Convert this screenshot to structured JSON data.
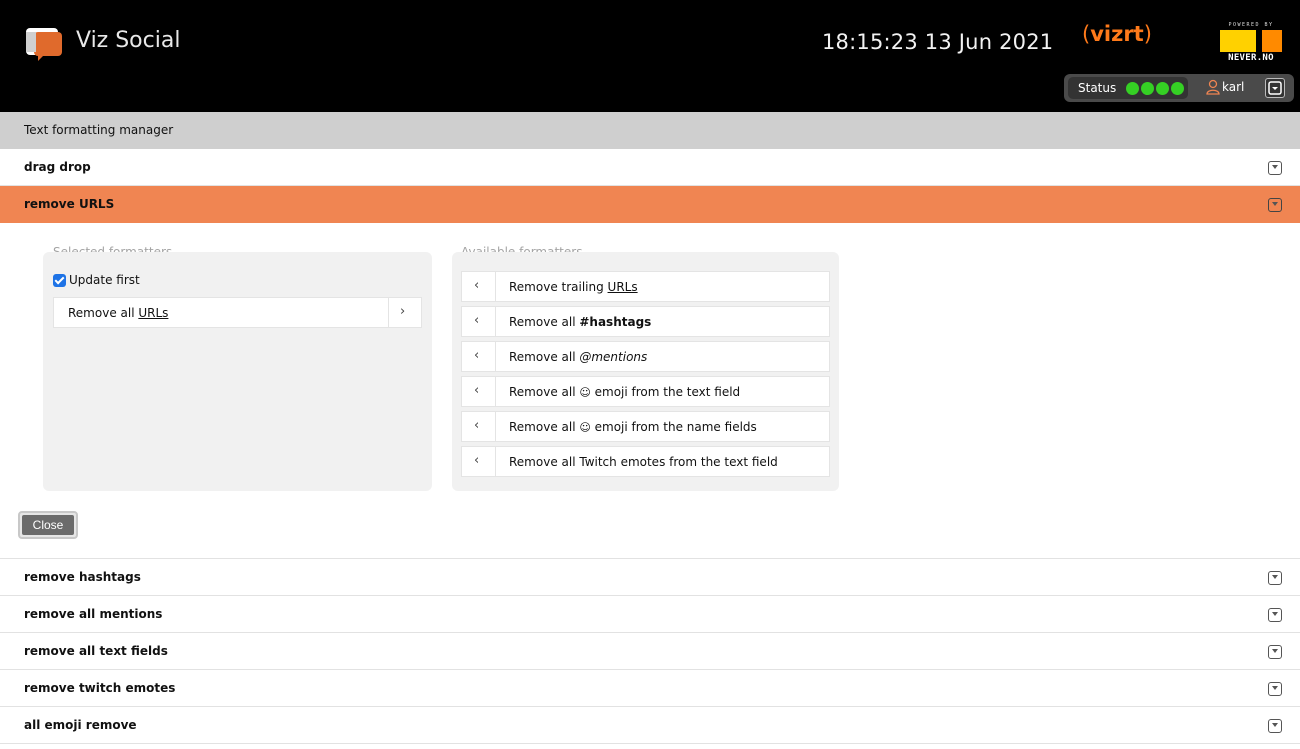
{
  "header": {
    "app_name": "Viz Social",
    "clock": "18:15:23 13 Jun 2021",
    "vizrt_brand": "vizrt",
    "never_powered": "POWERED BY",
    "never_brand": "NEVER.NO",
    "status_label": "Status",
    "status_dots": [
      "green",
      "green",
      "green",
      "green"
    ],
    "user_name": "karl",
    "colors": {
      "status_ok": "#35d024",
      "vizrt": "#ff7a1a",
      "active_row": "#f08552"
    }
  },
  "breadcrumb": "Text formatting manager",
  "rows": {
    "drag_drop": "drag drop",
    "remove_urls": "remove URLS",
    "remove_hashtags": "remove hashtags",
    "remove_mentions": "remove all mentions",
    "remove_text_fields": "remove all text fields",
    "remove_twitch": "remove twitch emotes",
    "all_emoji": "all emoji remove"
  },
  "panel": {
    "selected_title": "Selected formatters",
    "available_title": "Available formatters",
    "update_first_label": "Update first",
    "update_first_checked": true,
    "selected_items": [
      {
        "prefix": "Remove all ",
        "styled": "URLs",
        "style": "underline"
      }
    ],
    "available_items": [
      {
        "prefix": "Remove trailing ",
        "styled": "URLs",
        "suffix": "",
        "style": "underline"
      },
      {
        "prefix": "Remove all ",
        "styled": "#hashtags",
        "suffix": "",
        "style": "bold"
      },
      {
        "prefix": "Remove all ",
        "styled": "@mentions",
        "suffix": "",
        "style": "italic"
      },
      {
        "prefix": "Remove all ",
        "styled": "☺",
        "suffix": " emoji from the text field",
        "style": "emoji"
      },
      {
        "prefix": "Remove all ",
        "styled": "☺",
        "suffix": " emoji from the name fields",
        "style": "emoji"
      },
      {
        "prefix": "Remove all Twitch emotes from the text field",
        "styled": "",
        "suffix": "",
        "style": "plain"
      }
    ],
    "close_label": "Close"
  },
  "icons": {
    "add_arrow": "‹",
    "remove_arrow": "›"
  }
}
